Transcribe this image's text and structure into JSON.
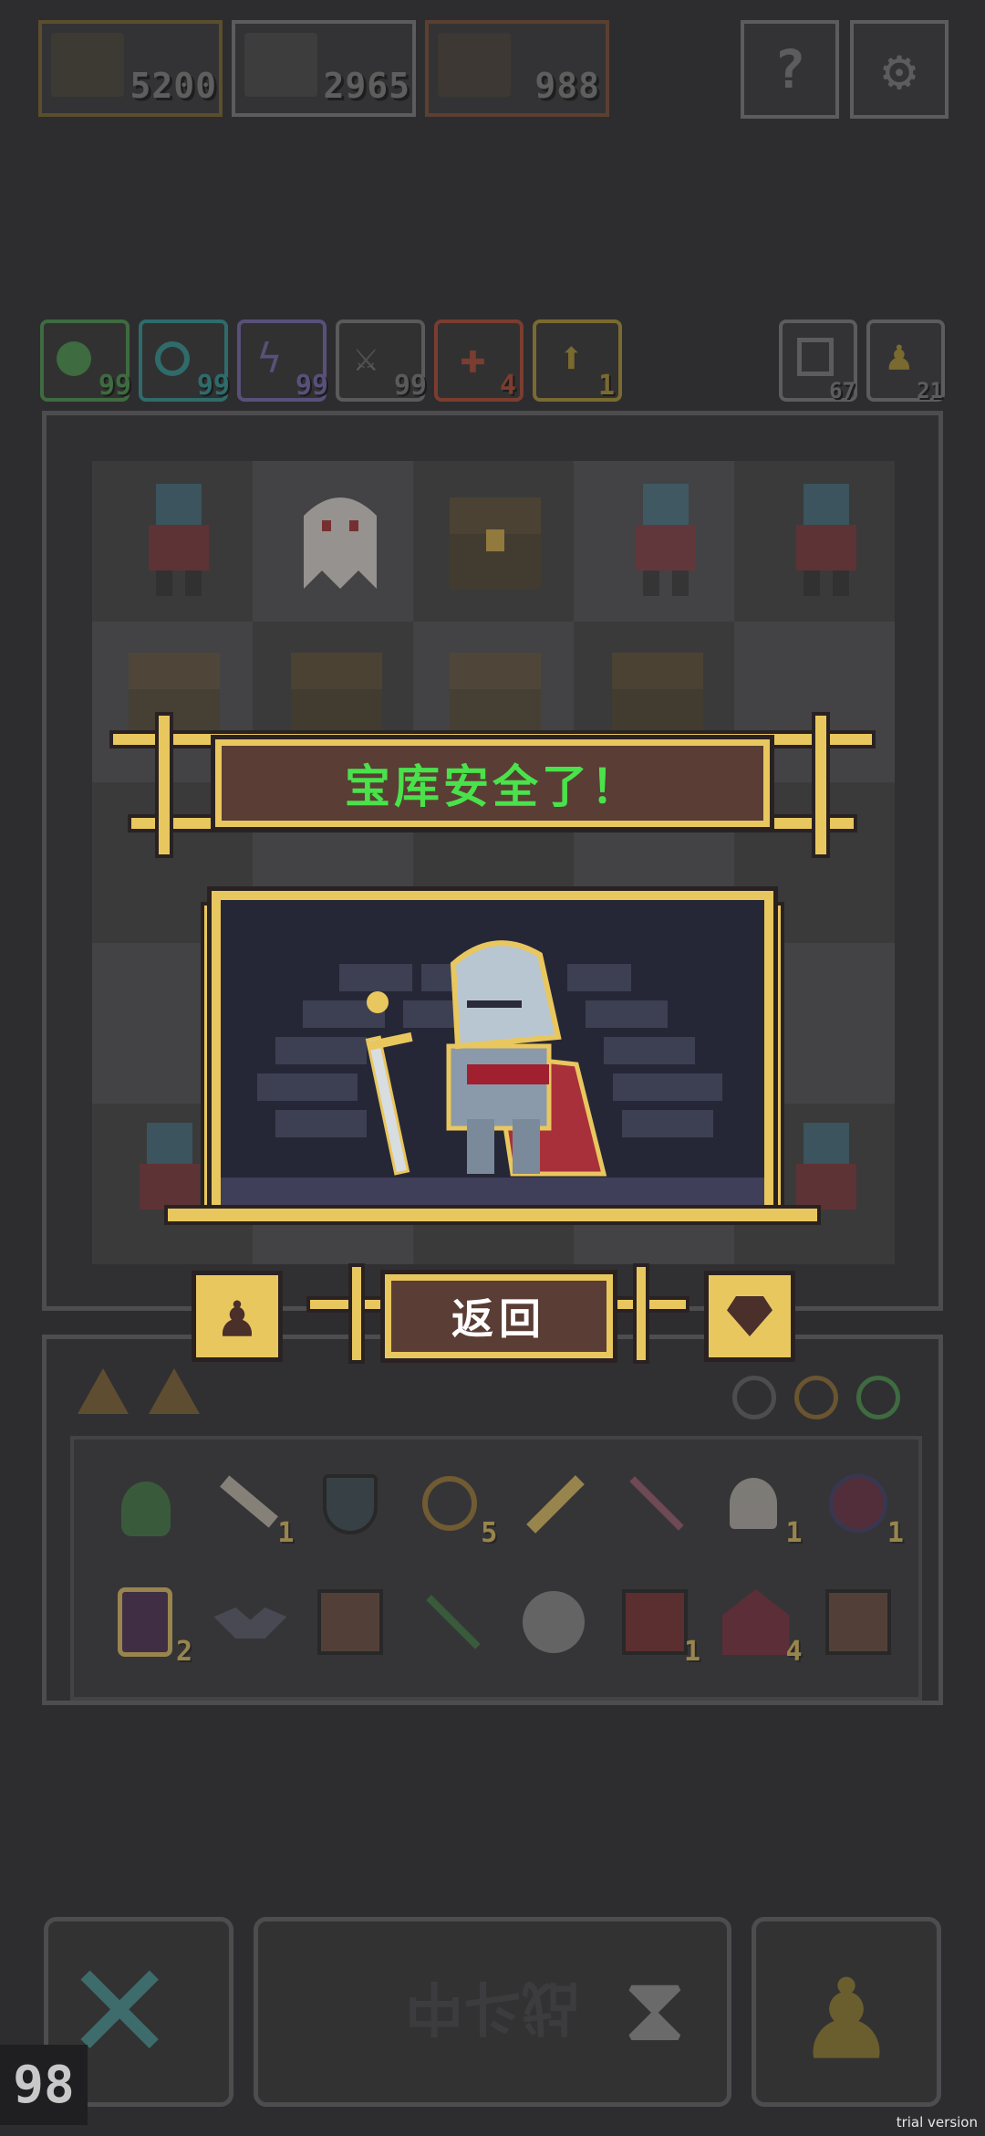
{
  "top_bar": {
    "counters": [
      {
        "value": "5200",
        "color": "#7d6a3a"
      },
      {
        "value": "2965",
        "color": "#6a6a6a"
      },
      {
        "value": "988",
        "color": "#7a5a3a"
      }
    ],
    "buttons": [
      {
        "icon": "help-icon",
        "glyph": "?"
      },
      {
        "icon": "settings-gear-icon",
        "glyph": "⚙"
      }
    ]
  },
  "resources": [
    {
      "icon": "green-key-icon",
      "value": "99",
      "color": "#3e6b40"
    },
    {
      "icon": "teal-swirl-icon",
      "value": "99",
      "color": "#2f6b6b"
    },
    {
      "icon": "lightning-icon",
      "value": "99",
      "color": "#59507a"
    },
    {
      "icon": "crossed-swords-icon",
      "value": "99",
      "color": "#5a5a5a"
    },
    {
      "icon": "red-cross-icon",
      "value": "4",
      "color": "#7a3d2f"
    },
    {
      "icon": "gold-arrow-icon",
      "value": "1",
      "color": "#7a6a30"
    }
  ],
  "right_counters": [
    {
      "icon": "box-stack-icon",
      "value": "67"
    },
    {
      "icon": "pawn-icon",
      "value": "21"
    }
  ],
  "modal": {
    "title": "宝库安全了！",
    "return_label": "返回",
    "colors": {
      "gold": "#e9c75f",
      "banner": "#5a3d34",
      "title_text": "#49e24b",
      "scene_bg": "#262736"
    }
  },
  "inventory": {
    "top_counters": [
      {
        "icon": "ore-icon"
      },
      {
        "icon": "ore-icon"
      }
    ],
    "row1": [
      {
        "icon": "green-slime-item-icon",
        "count": ""
      },
      {
        "icon": "bone-item-icon",
        "count": "1"
      },
      {
        "icon": "shield-item-icon",
        "count": ""
      },
      {
        "icon": "planet-item-icon",
        "count": "5"
      },
      {
        "icon": "purple-key-item-icon",
        "count": ""
      },
      {
        "icon": "arrow-item-icon",
        "count": ""
      },
      {
        "icon": "ghost-item-icon",
        "count": "1"
      },
      {
        "icon": "bat-orb-item-icon",
        "count": "1"
      }
    ],
    "row2": [
      {
        "icon": "potion-jar-item-icon",
        "count": "2"
      },
      {
        "icon": "bat-item-icon",
        "count": ""
      },
      {
        "icon": "rune-crate-item-icon",
        "count": ""
      },
      {
        "icon": "green-arrow-item-icon",
        "count": ""
      },
      {
        "icon": "stone-orb-item-icon",
        "count": ""
      },
      {
        "icon": "demon-crate-item-icon",
        "count": "1"
      },
      {
        "icon": "demon-tent-item-icon",
        "count": "4"
      },
      {
        "icon": "rune-crate-item-icon",
        "count": ""
      }
    ]
  },
  "bottom_bar": {
    "battle_label": "战斗中",
    "turn_counter": "98"
  },
  "watermark": "trial version"
}
